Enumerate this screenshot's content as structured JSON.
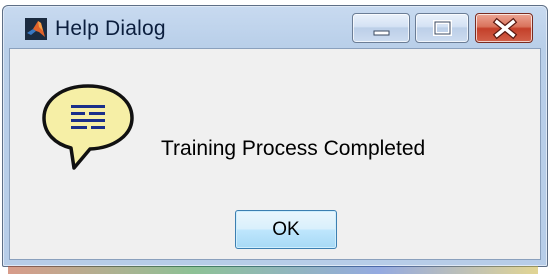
{
  "window": {
    "title": "Help Dialog",
    "app_icon": "matlab-logo-icon",
    "controls": {
      "minimize_icon": "minimize-icon",
      "maximize_icon": "maximize-icon",
      "close_icon": "close-icon"
    }
  },
  "dialog": {
    "icon": "help-speech-bubble-icon",
    "message": "Training Process Completed",
    "ok_label": "OK"
  },
  "colors": {
    "title_bar": "#b9cfe9",
    "client_background": "#f0f0f0",
    "close_button": "#c4402a",
    "bubble_fill": "#f6efa6",
    "bubble_lines": "#1a2f8a",
    "ok_button": "#bee6fd"
  }
}
